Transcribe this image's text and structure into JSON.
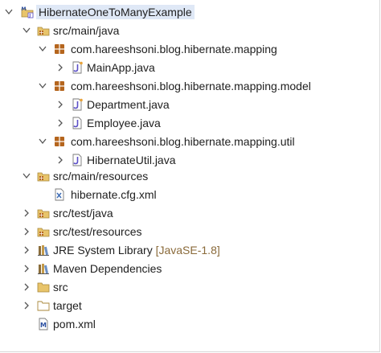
{
  "tree": {
    "root": {
      "label": "HibernateOneToManyExample",
      "icon": "maven-project-icon",
      "expanded": true
    },
    "src_main_java": {
      "label": "src/main/java",
      "icon": "source-folder-icon",
      "expanded": true
    },
    "pkg_mapping": {
      "label": "com.hareeshsoni.blog.hibernate.mapping",
      "icon": "package-icon",
      "expanded": true
    },
    "mainapp": {
      "label": "MainApp.java",
      "icon": "java-file-icon"
    },
    "pkg_model": {
      "label": "com.hareeshsoni.blog.hibernate.mapping.model",
      "icon": "package-icon",
      "expanded": true
    },
    "department": {
      "label": "Department.java",
      "icon": "java-file-icon"
    },
    "employee": {
      "label": "Employee.java",
      "icon": "java-file-icon"
    },
    "pkg_util": {
      "label": "com.hareeshsoni.blog.hibernate.mapping.util",
      "icon": "package-icon",
      "expanded": true
    },
    "hibernateutil": {
      "label": "HibernateUtil.java",
      "icon": "java-file-icon"
    },
    "src_main_resources": {
      "label": "src/main/resources",
      "icon": "source-folder-icon",
      "expanded": true
    },
    "cfg": {
      "label": "hibernate.cfg.xml",
      "icon": "xml-file-icon"
    },
    "src_test_java": {
      "label": "src/test/java",
      "icon": "source-folder-icon"
    },
    "src_test_resources": {
      "label": "src/test/resources",
      "icon": "source-folder-icon"
    },
    "jre": {
      "label": "JRE System Library",
      "suffix": "[JavaSE-1.8]",
      "icon": "library-icon"
    },
    "maven_deps": {
      "label": "Maven Dependencies",
      "icon": "library-icon"
    },
    "src": {
      "label": "src",
      "icon": "folder-icon"
    },
    "target": {
      "label": "target",
      "icon": "folder-icon"
    },
    "pom": {
      "label": "pom.xml",
      "icon": "maven-pom-icon"
    }
  },
  "colors": {
    "selection": "#dfe8f6",
    "package": "#b5651d",
    "java_j": "#5b4fc7",
    "folder": "#e8c46a",
    "library": "#8a6d3b",
    "suffix": "#8a6a3a"
  }
}
